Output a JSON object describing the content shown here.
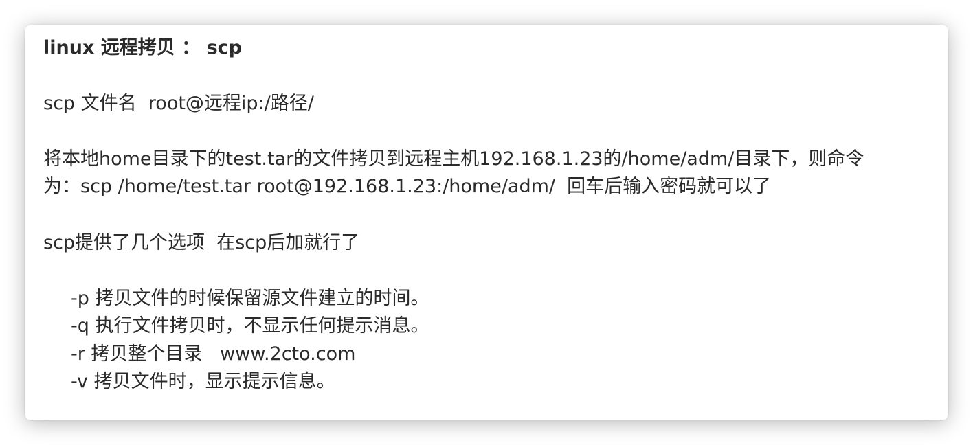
{
  "document": {
    "title": "linux 远程拷贝 ： scp",
    "syntax": "scp 文件名  root@远程ip:/路径/",
    "example_line1": "将本地home目录下的test.tar的文件拷贝到远程主机192.168.1.23的/home/adm/目录下，则命令",
    "example_line2": "为：scp /home/test.tar root@192.168.1.23:/home/adm/  回车后输入密码就可以了",
    "options_intro": "scp提供了几个选项  在scp后加就行了",
    "options": [
      "-p 拷贝文件的时候保留源文件建立的时间。",
      "-q 执行文件拷贝时，不显示任何提示消息。",
      "-r 拷贝整个目录   www.2cto.com",
      "-v 拷贝文件时，显示提示信息。"
    ]
  }
}
